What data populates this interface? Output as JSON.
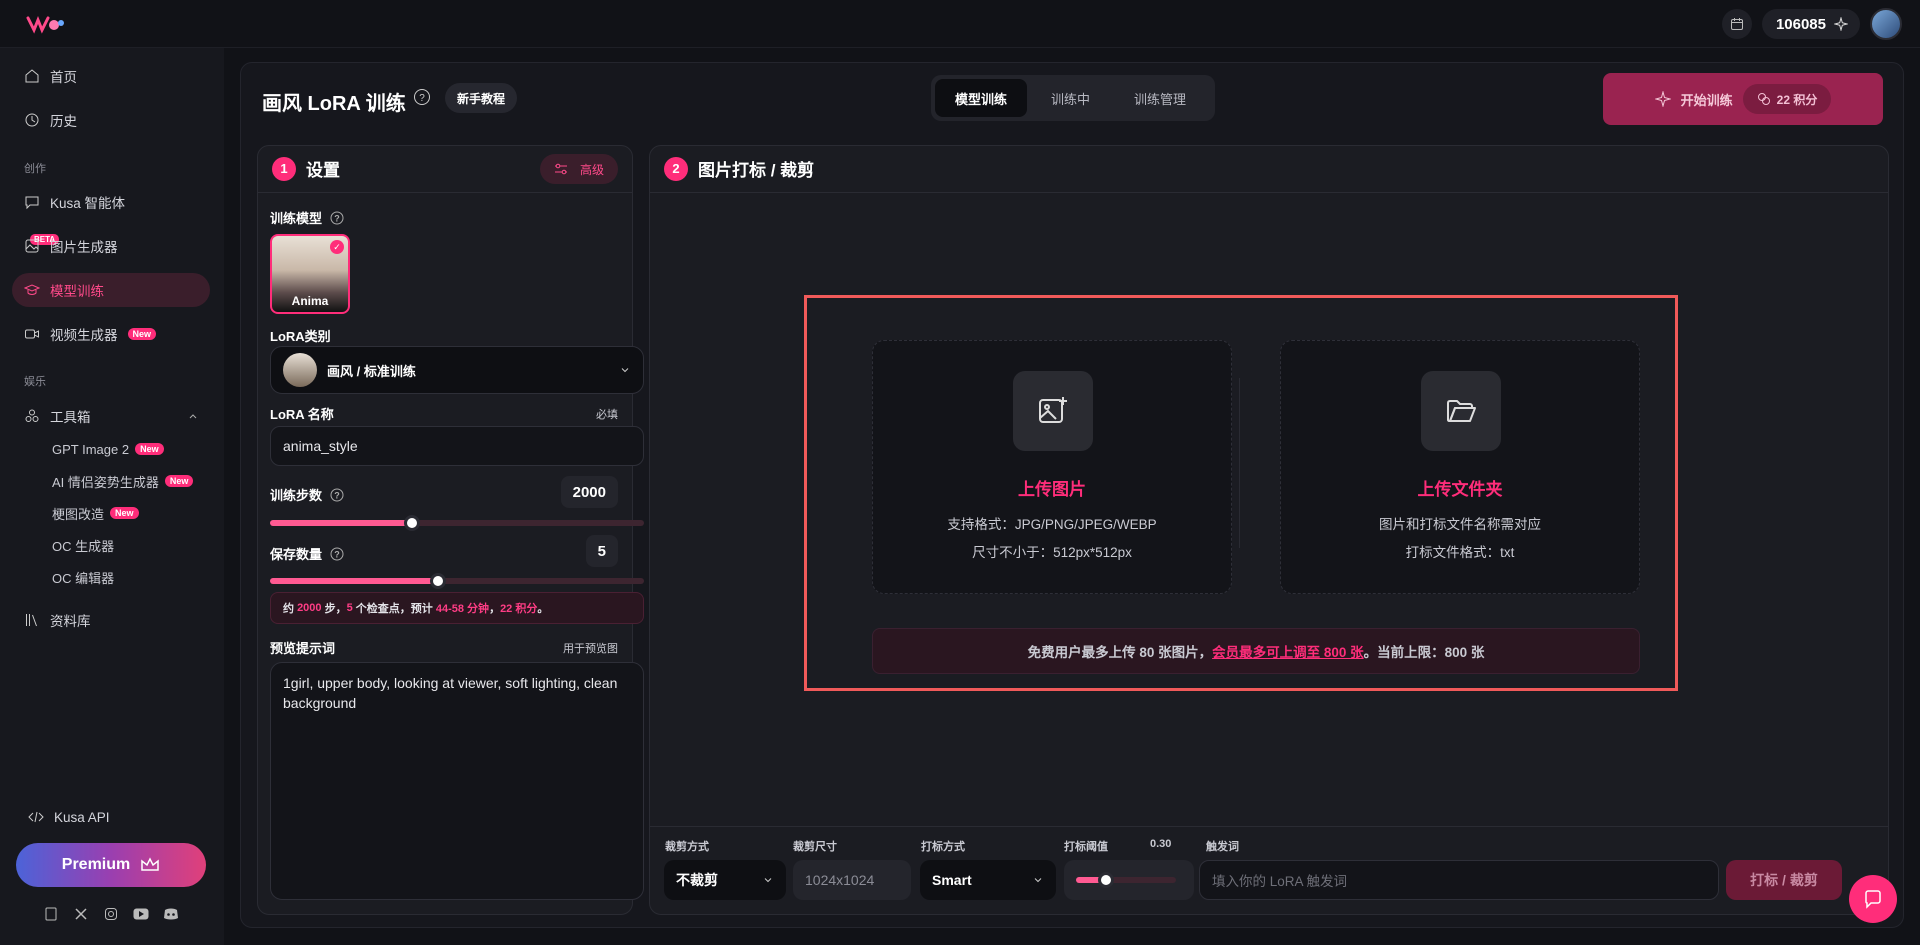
{
  "header": {
    "credits": "106085"
  },
  "sidebar": {
    "items": [
      {
        "label": "首页"
      },
      {
        "label": "历史"
      },
      {
        "label": "Kusa 智能体"
      },
      {
        "label": "图片生成器"
      },
      {
        "label": "模型训练"
      },
      {
        "label": "视频生成器"
      },
      {
        "label": "工具箱"
      },
      {
        "label": "资料库"
      }
    ],
    "section_create": "创作",
    "section_fun": "娱乐",
    "beta_badge": "BETA",
    "new_badge": "New",
    "tools": [
      {
        "label": "GPT Image 2",
        "badge": "New"
      },
      {
        "label": "AI 情侣姿势生成器",
        "badge": "New"
      },
      {
        "label": "梗图改造",
        "badge": "New"
      },
      {
        "label": "OC 生成器"
      },
      {
        "label": "OC 编辑器"
      }
    ],
    "api_label": "Kusa API",
    "premium_label": "Premium"
  },
  "page": {
    "title": "画风 LoRA 训练",
    "tutorial": "新手教程",
    "tabs": [
      "模型训练",
      "训练中",
      "训练管理"
    ],
    "start_label": "开始训练",
    "cost": "22 积分"
  },
  "settings": {
    "step": "1",
    "title": "设置",
    "advanced": "高级",
    "model_label": "训练模型",
    "model_name": "Anima",
    "lora_type_label": "LoRA类别",
    "lora_type_value": "画风 / 标准训练",
    "lora_name_label": "LoRA 名称",
    "required": "必填",
    "lora_name_value": "anima_style",
    "steps_label": "训练步数",
    "steps_value": "2000",
    "steps_fraction": 0.38,
    "save_label": "保存数量",
    "save_value": "5",
    "save_fraction": 0.45,
    "info": {
      "p1": "约 ",
      "steps": "2000",
      "p2": " 步，",
      "ckpt": "5",
      "p3": " 个检查点，预计 ",
      "time": "44-58 分钟",
      "p4": "，",
      "cost": "22 积分",
      "p5": "。"
    },
    "prompt_label": "预览提示词",
    "prompt_hint": "用于预览图",
    "prompt_value": "1girl, upper body, looking at viewer, soft lighting, clean background"
  },
  "upload": {
    "step": "2",
    "title": "图片打标 / 裁剪",
    "images": {
      "title": "上传图片",
      "line1": "支持格式：JPG/PNG/JPEG/WEBP",
      "line2": "尺寸不小于：512px*512px"
    },
    "folder": {
      "title": "上传文件夹",
      "line1": "图片和打标文件名称需对应",
      "line2": "打标文件格式：txt"
    },
    "limit": {
      "p1": "免费用户最多上传 80 张图片，",
      "link": "会员最多可上调至 800 张",
      "p2": "。当前上限：800 张"
    }
  },
  "controls": {
    "crop_mode_label": "裁剪方式",
    "crop_mode_value": "不裁剪",
    "crop_size_label": "裁剪尺寸",
    "crop_size_value": "1024x1024",
    "tag_mode_label": "打标方式",
    "tag_mode_value": "Smart",
    "threshold_label": "打标阈值",
    "threshold_value": "0.30",
    "threshold_fraction": 0.3,
    "trigger_label": "触发词",
    "trigger_placeholder": "填入你的 LoRA 触发词",
    "tag_button": "打标 / 裁剪"
  },
  "colors": {
    "accent": "#ff2d7a",
    "highlight_box": "#f05a5a"
  }
}
